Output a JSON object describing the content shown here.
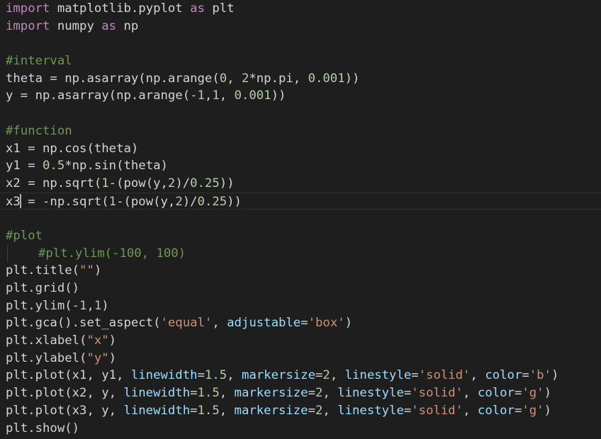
{
  "editor": {
    "colors": {
      "background": "#1e1e1e",
      "default": "#d4d4d4",
      "keyword": "#c586c0",
      "comment": "#6a9955",
      "number": "#b5cea8",
      "string": "#ce9178",
      "param": "#9cdcfe"
    },
    "cursor_line": 12,
    "lines": [
      [
        {
          "t": "import",
          "c": "keyword"
        },
        {
          "t": " matplotlib.pyplot ",
          "c": "default"
        },
        {
          "t": "as",
          "c": "keyword"
        },
        {
          "t": " plt",
          "c": "default"
        }
      ],
      [
        {
          "t": "import",
          "c": "keyword"
        },
        {
          "t": " numpy ",
          "c": "default"
        },
        {
          "t": "as",
          "c": "keyword"
        },
        {
          "t": " np",
          "c": "default"
        }
      ],
      [],
      [
        {
          "t": "#interval",
          "c": "comment"
        }
      ],
      [
        {
          "t": "theta = np.asarray(np.arange(",
          "c": "default"
        },
        {
          "t": "0",
          "c": "number"
        },
        {
          "t": ", ",
          "c": "default"
        },
        {
          "t": "2",
          "c": "number"
        },
        {
          "t": "*np.pi, ",
          "c": "default"
        },
        {
          "t": "0.001",
          "c": "number"
        },
        {
          "t": "))",
          "c": "default"
        }
      ],
      [
        {
          "t": "y = np.asarray(np.arange(",
          "c": "default"
        },
        {
          "t": "-1",
          "c": "number"
        },
        {
          "t": ",",
          "c": "default"
        },
        {
          "t": "1",
          "c": "number"
        },
        {
          "t": ", ",
          "c": "default"
        },
        {
          "t": "0.001",
          "c": "number"
        },
        {
          "t": "))",
          "c": "default"
        }
      ],
      [],
      [
        {
          "t": "#function",
          "c": "comment"
        }
      ],
      [
        {
          "t": "x1 = np.cos(theta)",
          "c": "default"
        }
      ],
      [
        {
          "t": "y1 = ",
          "c": "default"
        },
        {
          "t": "0.5",
          "c": "number"
        },
        {
          "t": "*np.sin(theta)",
          "c": "default"
        }
      ],
      [
        {
          "t": "x2 = np.sqrt(",
          "c": "default"
        },
        {
          "t": "1",
          "c": "number"
        },
        {
          "t": "-(pow(y,",
          "c": "default"
        },
        {
          "t": "2",
          "c": "number"
        },
        {
          "t": ")/",
          "c": "default"
        },
        {
          "t": "0.25",
          "c": "number"
        },
        {
          "t": "))",
          "c": "default"
        }
      ],
      [
        {
          "t": "x3",
          "c": "default"
        },
        {
          "t": "",
          "c": "cursor"
        },
        {
          "t": " = -np.sqrt(",
          "c": "default"
        },
        {
          "t": "1",
          "c": "number"
        },
        {
          "t": "-(pow(y,",
          "c": "default"
        },
        {
          "t": "2",
          "c": "number"
        },
        {
          "t": ")/",
          "c": "default"
        },
        {
          "t": "0.25",
          "c": "number"
        },
        {
          "t": "))",
          "c": "default"
        }
      ],
      [],
      [
        {
          "t": "#plot",
          "c": "comment"
        }
      ],
      [
        {
          "t": "",
          "c": "indent"
        },
        {
          "t": "#plt.ylim(-100, 100)",
          "c": "comment"
        }
      ],
      [
        {
          "t": "plt.title(",
          "c": "default"
        },
        {
          "t": "\"\"",
          "c": "string"
        },
        {
          "t": ")",
          "c": "default"
        }
      ],
      [
        {
          "t": "plt.grid()",
          "c": "default"
        }
      ],
      [
        {
          "t": "plt.ylim(",
          "c": "default"
        },
        {
          "t": "-1",
          "c": "number"
        },
        {
          "t": ",",
          "c": "default"
        },
        {
          "t": "1",
          "c": "number"
        },
        {
          "t": ")",
          "c": "default"
        }
      ],
      [
        {
          "t": "plt.gca().set_aspect(",
          "c": "default"
        },
        {
          "t": "'equal'",
          "c": "string"
        },
        {
          "t": ", ",
          "c": "default"
        },
        {
          "t": "adjustable",
          "c": "param"
        },
        {
          "t": "=",
          "c": "default"
        },
        {
          "t": "'box'",
          "c": "string"
        },
        {
          "t": ")",
          "c": "default"
        }
      ],
      [
        {
          "t": "plt.xlabel(",
          "c": "default"
        },
        {
          "t": "\"x\"",
          "c": "string"
        },
        {
          "t": ")",
          "c": "default"
        }
      ],
      [
        {
          "t": "plt.ylabel(",
          "c": "default"
        },
        {
          "t": "\"y\"",
          "c": "string"
        },
        {
          "t": ")",
          "c": "default"
        }
      ],
      [
        {
          "t": "plt.plot(x1, y1, ",
          "c": "default"
        },
        {
          "t": "linewidth",
          "c": "param"
        },
        {
          "t": "=",
          "c": "default"
        },
        {
          "t": "1.5",
          "c": "number"
        },
        {
          "t": ", ",
          "c": "default"
        },
        {
          "t": "markersize",
          "c": "param"
        },
        {
          "t": "=",
          "c": "default"
        },
        {
          "t": "2",
          "c": "number"
        },
        {
          "t": ", ",
          "c": "default"
        },
        {
          "t": "linestyle",
          "c": "param"
        },
        {
          "t": "=",
          "c": "default"
        },
        {
          "t": "'solid'",
          "c": "string"
        },
        {
          "t": ", ",
          "c": "default"
        },
        {
          "t": "color",
          "c": "param"
        },
        {
          "t": "=",
          "c": "default"
        },
        {
          "t": "'b'",
          "c": "string"
        },
        {
          "t": ")",
          "c": "default"
        }
      ],
      [
        {
          "t": "plt.plot(x2, y, ",
          "c": "default"
        },
        {
          "t": "linewidth",
          "c": "param"
        },
        {
          "t": "=",
          "c": "default"
        },
        {
          "t": "1.5",
          "c": "number"
        },
        {
          "t": ", ",
          "c": "default"
        },
        {
          "t": "markersize",
          "c": "param"
        },
        {
          "t": "=",
          "c": "default"
        },
        {
          "t": "2",
          "c": "number"
        },
        {
          "t": ", ",
          "c": "default"
        },
        {
          "t": "linestyle",
          "c": "param"
        },
        {
          "t": "=",
          "c": "default"
        },
        {
          "t": "'solid'",
          "c": "string"
        },
        {
          "t": ", ",
          "c": "default"
        },
        {
          "t": "color",
          "c": "param"
        },
        {
          "t": "=",
          "c": "default"
        },
        {
          "t": "'g'",
          "c": "string"
        },
        {
          "t": ")",
          "c": "default"
        }
      ],
      [
        {
          "t": "plt.plot(x3, y, ",
          "c": "default"
        },
        {
          "t": "linewidth",
          "c": "param"
        },
        {
          "t": "=",
          "c": "default"
        },
        {
          "t": "1.5",
          "c": "number"
        },
        {
          "t": ", ",
          "c": "default"
        },
        {
          "t": "markersize",
          "c": "param"
        },
        {
          "t": "=",
          "c": "default"
        },
        {
          "t": "2",
          "c": "number"
        },
        {
          "t": ", ",
          "c": "default"
        },
        {
          "t": "linestyle",
          "c": "param"
        },
        {
          "t": "=",
          "c": "default"
        },
        {
          "t": "'solid'",
          "c": "string"
        },
        {
          "t": ", ",
          "c": "default"
        },
        {
          "t": "color",
          "c": "param"
        },
        {
          "t": "=",
          "c": "default"
        },
        {
          "t": "'g'",
          "c": "string"
        },
        {
          "t": ")",
          "c": "default"
        }
      ],
      [
        {
          "t": "plt.show()",
          "c": "default"
        }
      ]
    ]
  }
}
